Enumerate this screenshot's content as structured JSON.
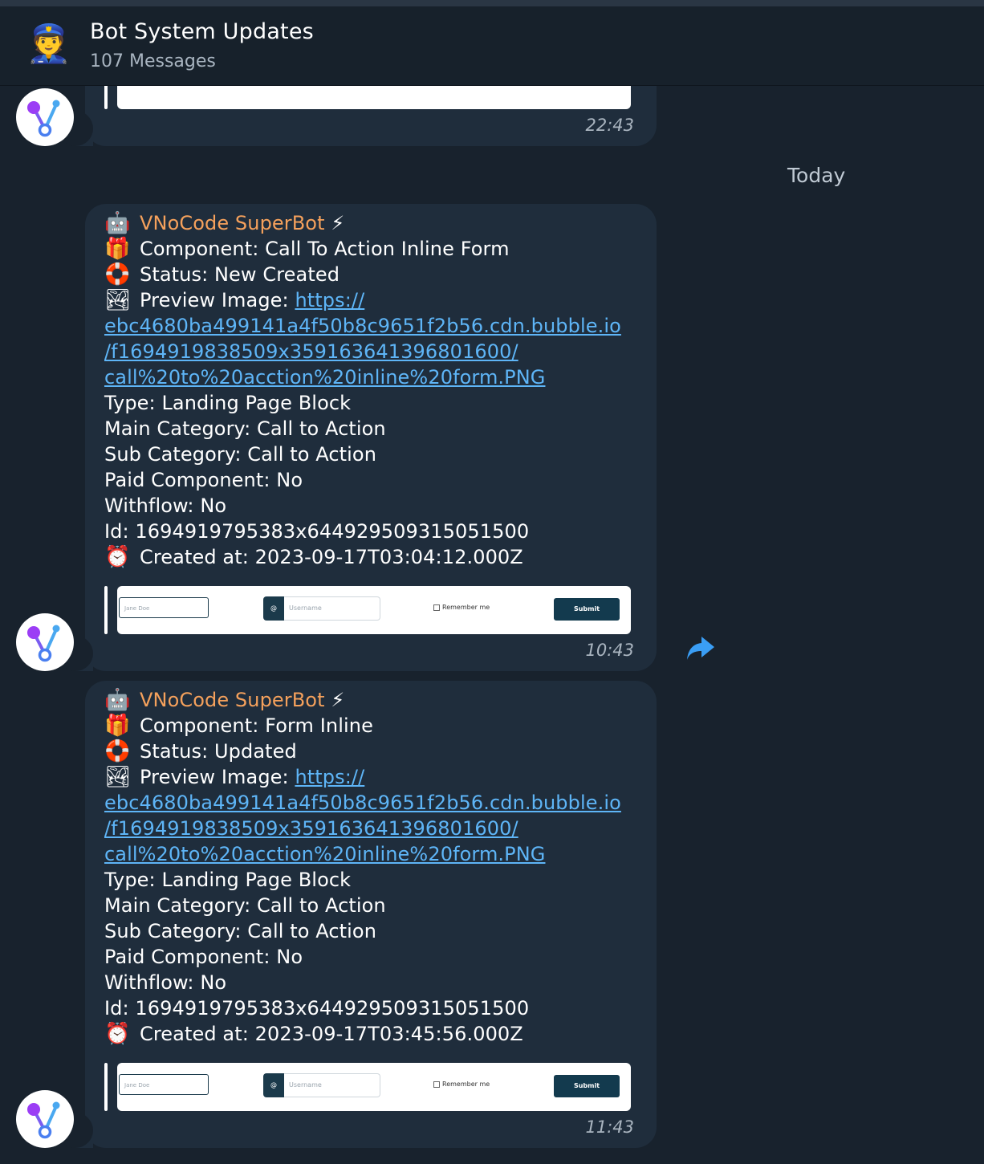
{
  "header": {
    "icon": "police-officer-emoji",
    "title": "Bot System Updates",
    "subtitle": "107 Messages"
  },
  "date_separator": "Today",
  "messages": [
    {
      "time": "22:43"
    },
    {
      "bot_name": "VNoCode SuperBot",
      "component": "Component: Call To Action Inline Form",
      "status": "Status: New Created",
      "preview_label": "Preview Image: ",
      "link_1": "https://",
      "link_2": "ebc4680ba499141a4f50b8c9651f2b56.cdn.bubble.io",
      "link_3": "/f1694919838509x359163641396801600/",
      "link_4": "call%20to%20acction%20inline%20form.PNG",
      "type": "Type: Landing Page Block",
      "main_category": "Main Category: Call to Action",
      "sub_category": "Sub Category:  Call to Action",
      "paid": "Paid Component: No",
      "withflow": "Withflow: No",
      "id": "Id: 1694919795383x644929509315051500",
      "created": "Created at: 2023-09-17T03:04:12.000Z",
      "preview": {
        "name_placeholder": "Jane Doe",
        "at_symbol": "@",
        "username_placeholder": "Username",
        "remember": "Remember me",
        "submit": "Submit"
      },
      "time": "10:43"
    },
    {
      "bot_name": "VNoCode SuperBot",
      "component": "Component: Form Inline",
      "status": "Status: Updated",
      "preview_label": "Preview Image: ",
      "link_1": "https://",
      "link_2": "ebc4680ba499141a4f50b8c9651f2b56.cdn.bubble.io",
      "link_3": "/f1694919838509x359163641396801600/",
      "link_4": "call%20to%20acction%20inline%20form.PNG",
      "type": "Type: Landing Page Block",
      "main_category": "Main Category: Call to Action",
      "sub_category": "Sub Category:  Call to Action",
      "paid": "Paid Component: No",
      "withflow": "Withflow: No",
      "id": "Id: 1694919795383x644929509315051500",
      "created": "Created at: 2023-09-17T03:45:56.000Z",
      "preview": {
        "name_placeholder": "Jane Doe",
        "at_symbol": "@",
        "username_placeholder": "Username",
        "remember": "Remember me",
        "submit": "Submit"
      },
      "time": "11:43"
    }
  ],
  "icons": {
    "robot": "robot-emoji",
    "lightning": "high-voltage-emoji",
    "gift": "gift-emoji",
    "lifebuoy": "ring-buoy-emoji",
    "picture": "picture-emoji",
    "alarm": "alarm-clock-emoji",
    "forward": "forward-arrow-icon",
    "avatar": "fork-logo-icon"
  },
  "colors": {
    "background": "#18222d",
    "bubble": "#1f2d3c",
    "bot_name": "#f5a15c",
    "link": "#5eb5f7",
    "forward": "#3a9ef5"
  }
}
